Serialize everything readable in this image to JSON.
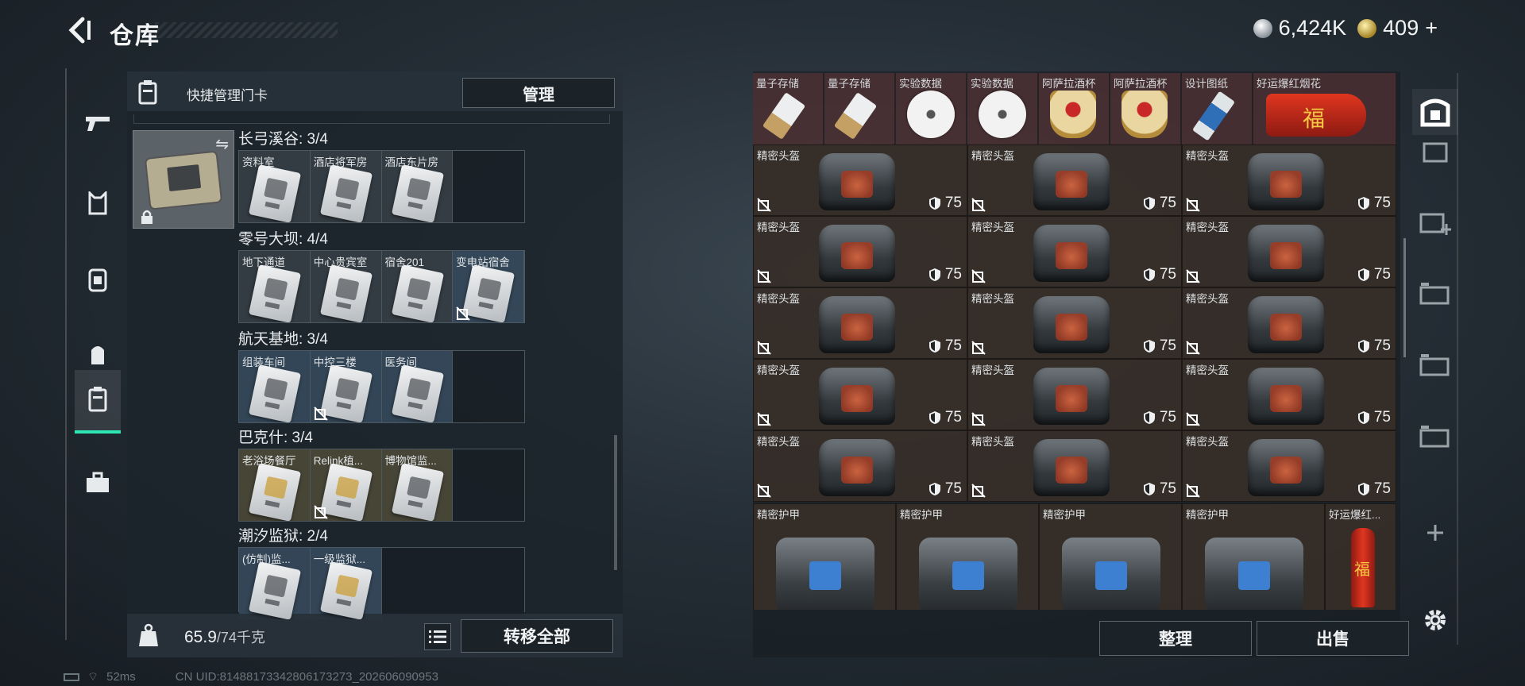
{
  "header": {
    "title": "仓库"
  },
  "currency": {
    "silver": "6,424K",
    "gold": "409",
    "add_symbol": "+"
  },
  "left_panel": {
    "header_title": "快捷管理门卡",
    "manage_label": "管理",
    "weight_current": "65.9",
    "weight_max": "/74千克",
    "transfer_label": "转移全部",
    "groups": [
      {
        "name": "长弓溪谷: 3/4",
        "keys": [
          "资料室",
          "酒店将军房",
          "酒店东片房"
        ]
      },
      {
        "name": "零号大坝: 4/4",
        "keys": [
          "地下通道",
          "中心贵宾室",
          "宿舍201",
          "变电站宿舍"
        ]
      },
      {
        "name": "航天基地: 3/4",
        "keys": [
          "组装车间",
          "中控三楼",
          "医务间"
        ]
      },
      {
        "name": "巴克什: 3/4",
        "keys": [
          "老浴场餐厅",
          "Relink植...",
          "博物馆监..."
        ]
      },
      {
        "name": "潮汐监狱: 2/4",
        "keys": [
          "(仿制)监...",
          "一级监狱..."
        ]
      }
    ]
  },
  "status_bar": {
    "ping": "52ms",
    "uid": "CN UID:814881733428061732​73_202606090953"
  },
  "right_panel": {
    "top_items": [
      "量子存储",
      "量子存储",
      "实验数据",
      "实验数据",
      "阿萨拉酒杯",
      "阿萨拉酒杯",
      "设计图纸",
      "好运爆红烟花"
    ],
    "helmet_label": "精密头盔",
    "durability": "75",
    "armor_label": "精密护甲",
    "firework_label": "好运爆红...",
    "sort_label": "整理",
    "sell_label": "出售"
  },
  "colors": {
    "accent": "#2ee6b4",
    "durability_text": "#eef0f1"
  },
  "icons": {
    "left_nav": [
      "gun-icon",
      "armor-vest-icon",
      "chest-rig-icon",
      "backpack-icon",
      "keycard-icon",
      "toolbox-icon"
    ],
    "right_nav": [
      "safe-box-icon",
      "storage-tab-icon",
      "storage-tab-add-icon",
      "storage-tab-icon",
      "storage-tab-icon",
      "storage-tab-icon",
      "add-icon",
      "settings-gear-icon"
    ]
  }
}
